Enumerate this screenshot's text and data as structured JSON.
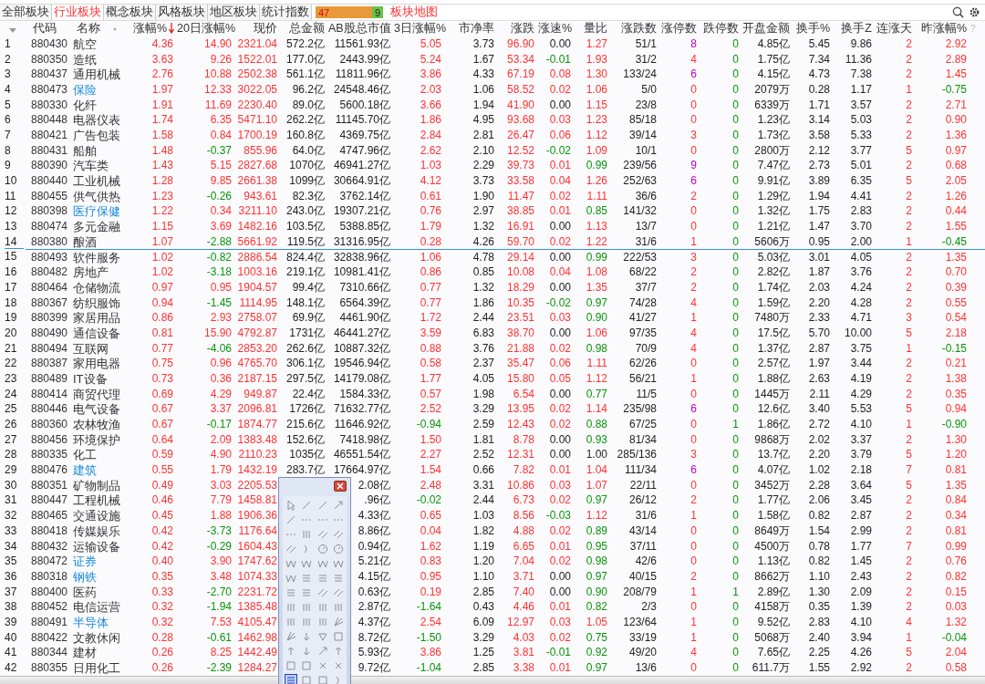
{
  "tabs": [
    {
      "label": "全部板块",
      "selected": false
    },
    {
      "label": "行业板块",
      "selected": true
    },
    {
      "label": "概念板块",
      "selected": false
    },
    {
      "label": "风格板块",
      "selected": false
    },
    {
      "label": "地区板块",
      "selected": false
    },
    {
      "label": "统计指数",
      "selected": false
    }
  ],
  "breadth": {
    "up": "47",
    "down": "9",
    "level": 0.84
  },
  "map_link": "板块地图",
  "tool_palette": {
    "open": true
  },
  "table": {
    "help_mark": "?",
    "columns": [
      {
        "kind": "index",
        "sorted": false
      },
      {
        "label": "代码",
        "kind": "code",
        "sorted": false
      },
      {
        "label": "名称",
        "kind": "name",
        "sorted": false
      },
      {
        "label": "涨幅%",
        "kind": "sign",
        "sorted": true
      },
      {
        "label": "20日涨幅%",
        "kind": "sign",
        "sorted": false
      },
      {
        "label": "现价",
        "kind": "follow",
        "sorted": false
      },
      {
        "label": "总金额",
        "kind": "plain",
        "sorted": false
      },
      {
        "label": "AB股总市值",
        "kind": "plain",
        "sorted": false
      },
      {
        "label": "3日涨幅%",
        "kind": "sign",
        "sorted": false
      },
      {
        "label": "市净率",
        "kind": "plain",
        "sorted": false
      },
      {
        "label": "涨跌",
        "kind": "follow",
        "sorted": false
      },
      {
        "label": "涨速%",
        "kind": "sign",
        "sorted": false
      },
      {
        "label": "量比",
        "kind": "ratio",
        "sorted": false
      },
      {
        "label": "涨跌数",
        "kind": "plain",
        "sorted": false
      },
      {
        "label": "涨停数",
        "kind": "limit_up",
        "sorted": false
      },
      {
        "label": "跌停数",
        "kind": "limit_down",
        "sorted": false
      },
      {
        "label": "开盘金额",
        "kind": "plain",
        "sorted": false
      },
      {
        "label": "换手%",
        "kind": "plain",
        "sorted": false
      },
      {
        "label": "换手Z",
        "kind": "plain",
        "sorted": false
      },
      {
        "label": "连涨天",
        "kind": "count",
        "sorted": false
      },
      {
        "label": "昨涨幅%",
        "kind": "sign",
        "sorted": false
      }
    ],
    "rows": [
      {
        "cells": [
          "1",
          "880430",
          "航空",
          "4.36",
          "14.90",
          "2321.04",
          "572.2亿",
          "11561.93亿",
          "5.05",
          "3.73",
          "96.90",
          "0.00",
          "1.27",
          "51/1",
          "8",
          "0",
          "4.85亿",
          "5.45",
          "9.86",
          "2",
          "2.92"
        ],
        "highlighted": false,
        "divider_after": false
      },
      {
        "cells": [
          "2",
          "880350",
          "造纸",
          "3.63",
          "9.26",
          "1522.01",
          "177.0亿",
          "2443.99亿",
          "5.24",
          "1.67",
          "53.34",
          "-0.01",
          "1.93",
          "31/2",
          "4",
          "0",
          "1.75亿",
          "7.34",
          "11.36",
          "2",
          "2.89"
        ],
        "highlighted": false,
        "divider_after": false
      },
      {
        "cells": [
          "3",
          "880437",
          "通用机械",
          "2.76",
          "10.88",
          "2502.38",
          "561.1亿",
          "11811.96亿",
          "3.86",
          "4.33",
          "67.19",
          "0.08",
          "1.30",
          "133/24",
          "6",
          "0",
          "4.15亿",
          "4.73",
          "7.38",
          "2",
          "1.45"
        ],
        "highlighted": false,
        "divider_after": false
      },
      {
        "cells": [
          "4",
          "880473",
          "保险",
          "1.97",
          "12.33",
          "3022.05",
          "96.2亿",
          "24548.46亿",
          "2.03",
          "1.06",
          "58.52",
          "0.02",
          "1.06",
          "5/0",
          "0",
          "0",
          "2079万",
          "0.28",
          "1.17",
          "1",
          "-0.75"
        ],
        "highlighted": true,
        "divider_after": false
      },
      {
        "cells": [
          "5",
          "880330",
          "化纤",
          "1.91",
          "11.69",
          "2230.40",
          "89.0亿",
          "5600.18亿",
          "3.66",
          "1.94",
          "41.90",
          "0.00",
          "1.15",
          "23/8",
          "0",
          "0",
          "6339万",
          "1.71",
          "3.57",
          "2",
          "2.71"
        ],
        "highlighted": false,
        "divider_after": false
      },
      {
        "cells": [
          "6",
          "880448",
          "电器仪表",
          "1.74",
          "6.35",
          "5471.10",
          "262.2亿",
          "11145.70亿",
          "1.86",
          "4.95",
          "93.68",
          "0.03",
          "1.23",
          "85/18",
          "0",
          "0",
          "1.23亿",
          "3.14",
          "5.03",
          "2",
          "0.90"
        ],
        "highlighted": false,
        "divider_after": false
      },
      {
        "cells": [
          "7",
          "880421",
          "广告包装",
          "1.58",
          "0.84",
          "1700.19",
          "160.8亿",
          "4369.75亿",
          "2.84",
          "2.81",
          "26.47",
          "0.06",
          "1.12",
          "39/14",
          "3",
          "0",
          "1.73亿",
          "3.58",
          "5.33",
          "2",
          "1.36"
        ],
        "highlighted": false,
        "divider_after": false
      },
      {
        "cells": [
          "8",
          "880431",
          "船舶",
          "1.48",
          "-0.37",
          "855.96",
          "64.0亿",
          "4747.96亿",
          "2.62",
          "2.10",
          "12.52",
          "-0.02",
          "1.09",
          "10/1",
          "0",
          "0",
          "2800万",
          "2.12",
          "3.77",
          "5",
          "0.97"
        ],
        "highlighted": false,
        "divider_after": false
      },
      {
        "cells": [
          "9",
          "880390",
          "汽车类",
          "1.43",
          "5.15",
          "2827.68",
          "1070亿",
          "46941.27亿",
          "1.03",
          "2.29",
          "39.73",
          "0.01",
          "0.99",
          "239/56",
          "9",
          "0",
          "7.47亿",
          "2.73",
          "5.01",
          "2",
          "0.68"
        ],
        "highlighted": false,
        "divider_after": false
      },
      {
        "cells": [
          "10",
          "880440",
          "工业机械",
          "1.28",
          "9.85",
          "2661.38",
          "1099亿",
          "30664.91亿",
          "4.12",
          "3.73",
          "33.58",
          "0.04",
          "1.26",
          "252/63",
          "6",
          "0",
          "9.91亿",
          "3.89",
          "6.35",
          "5",
          "2.05"
        ],
        "highlighted": false,
        "divider_after": false
      },
      {
        "cells": [
          "11",
          "880455",
          "供气供热",
          "1.23",
          "-0.26",
          "943.61",
          "82.3亿",
          "3762.14亿",
          "0.61",
          "1.90",
          "11.47",
          "0.02",
          "1.11",
          "36/6",
          "2",
          "0",
          "1.29亿",
          "1.94",
          "4.41",
          "2",
          "1.26"
        ],
        "highlighted": false,
        "divider_after": false
      },
      {
        "cells": [
          "12",
          "880398",
          "医疗保健",
          "1.22",
          "0.34",
          "3211.10",
          "243.0亿",
          "19307.21亿",
          "0.76",
          "2.97",
          "38.85",
          "0.01",
          "0.85",
          "141/32",
          "0",
          "0",
          "1.32亿",
          "1.75",
          "2.83",
          "2",
          "0.44"
        ],
        "highlighted": true,
        "divider_after": false
      },
      {
        "cells": [
          "13",
          "880474",
          "多元金融",
          "1.15",
          "3.69",
          "1482.16",
          "103.5亿",
          "5388.85亿",
          "1.79",
          "1.32",
          "16.91",
          "0.00",
          "1.13",
          "13/7",
          "0",
          "0",
          "1.21亿",
          "1.47",
          "3.70",
          "2",
          "1.55"
        ],
        "highlighted": false,
        "divider_after": false
      },
      {
        "cells": [
          "14",
          "880380",
          "酿酒",
          "1.07",
          "-2.88",
          "5661.92",
          "119.5亿",
          "31316.95亿",
          "0.28",
          "4.26",
          "59.70",
          "0.02",
          "1.22",
          "31/6",
          "1",
          "0",
          "5606万",
          "0.95",
          "2.00",
          "1",
          "-0.45"
        ],
        "highlighted": false,
        "divider_after": true
      },
      {
        "cells": [
          "15",
          "880493",
          "软件服务",
          "1.02",
          "-0.82",
          "2886.54",
          "824.4亿",
          "32838.96亿",
          "1.06",
          "4.78",
          "29.14",
          "0.00",
          "0.99",
          "222/53",
          "3",
          "0",
          "5.03亿",
          "3.01",
          "4.05",
          "2",
          "1.35"
        ],
        "highlighted": false,
        "divider_after": false
      },
      {
        "cells": [
          "16",
          "880482",
          "房地产",
          "1.02",
          "-3.18",
          "1003.16",
          "219.1亿",
          "10981.41亿",
          "0.86",
          "0.85",
          "10.08",
          "0.04",
          "1.08",
          "68/22",
          "2",
          "0",
          "2.82亿",
          "1.87",
          "3.76",
          "2",
          "0.70"
        ],
        "highlighted": false,
        "divider_after": false
      },
      {
        "cells": [
          "17",
          "880464",
          "仓储物流",
          "0.97",
          "0.95",
          "1904.57",
          "99.4亿",
          "7310.66亿",
          "0.77",
          "1.32",
          "18.29",
          "0.00",
          "1.35",
          "37/7",
          "2",
          "0",
          "1.74亿",
          "2.03",
          "4.24",
          "2",
          "0.39"
        ],
        "highlighted": false,
        "divider_after": false
      },
      {
        "cells": [
          "18",
          "880367",
          "纺织服饰",
          "0.94",
          "-1.45",
          "1114.95",
          "148.1亿",
          "6564.39亿",
          "0.77",
          "1.86",
          "10.35",
          "-0.02",
          "0.97",
          "74/28",
          "4",
          "0",
          "1.59亿",
          "2.20",
          "4.28",
          "2",
          "0.55"
        ],
        "highlighted": false,
        "divider_after": false
      },
      {
        "cells": [
          "19",
          "880399",
          "家居用品",
          "0.86",
          "2.93",
          "2758.07",
          "69.9亿",
          "4461.90亿",
          "1.72",
          "2.44",
          "23.51",
          "0.03",
          "0.90",
          "41/27",
          "1",
          "0",
          "7480万",
          "2.33",
          "4.71",
          "3",
          "0.54"
        ],
        "highlighted": false,
        "divider_after": false
      },
      {
        "cells": [
          "20",
          "880490",
          "通信设备",
          "0.81",
          "15.90",
          "4792.87",
          "1731亿",
          "46441.27亿",
          "3.59",
          "6.83",
          "38.70",
          "0.00",
          "1.06",
          "97/35",
          "4",
          "0",
          "17.5亿",
          "5.70",
          "10.00",
          "5",
          "2.18"
        ],
        "highlighted": false,
        "divider_after": false
      },
      {
        "cells": [
          "21",
          "880494",
          "互联网",
          "0.77",
          "-4.06",
          "2853.20",
          "262.6亿",
          "10887.32亿",
          "0.88",
          "3.76",
          "21.88",
          "0.02",
          "0.98",
          "70/9",
          "4",
          "0",
          "1.37亿",
          "2.87",
          "3.75",
          "1",
          "-0.15"
        ],
        "highlighted": false,
        "divider_after": false
      },
      {
        "cells": [
          "22",
          "880387",
          "家用电器",
          "0.75",
          "0.96",
          "4765.70",
          "306.1亿",
          "19546.94亿",
          "0.58",
          "2.37",
          "35.47",
          "0.06",
          "1.11",
          "62/26",
          "0",
          "0",
          "2.57亿",
          "1.97",
          "3.44",
          "2",
          "0.21"
        ],
        "highlighted": false,
        "divider_after": false
      },
      {
        "cells": [
          "23",
          "880489",
          "IT设备",
          "0.73",
          "0.36",
          "2187.15",
          "297.5亿",
          "14179.08亿",
          "1.77",
          "4.05",
          "15.80",
          "0.05",
          "1.12",
          "56/21",
          "1",
          "0",
          "1.88亿",
          "2.63",
          "4.19",
          "2",
          "1.38"
        ],
        "highlighted": false,
        "divider_after": false
      },
      {
        "cells": [
          "24",
          "880414",
          "商贸代理",
          "0.69",
          "4.29",
          "949.87",
          "22.4亿",
          "1584.33亿",
          "0.57",
          "1.98",
          "6.54",
          "0.00",
          "0.77",
          "11/5",
          "0",
          "0",
          "1445万",
          "2.11",
          "4.29",
          "2",
          "0.35"
        ],
        "highlighted": false,
        "divider_after": false
      },
      {
        "cells": [
          "25",
          "880446",
          "电气设备",
          "0.67",
          "3.37",
          "2096.81",
          "1726亿",
          "71632.77亿",
          "2.52",
          "3.29",
          "13.95",
          "0.02",
          "1.14",
          "235/98",
          "6",
          "0",
          "12.6亿",
          "3.40",
          "5.53",
          "5",
          "0.94"
        ],
        "highlighted": false,
        "divider_after": false
      },
      {
        "cells": [
          "26",
          "880360",
          "农林牧渔",
          "0.67",
          "-0.17",
          "1874.77",
          "215.6亿",
          "11646.92亿",
          "-0.94",
          "2.59",
          "12.43",
          "0.02",
          "0.88",
          "67/25",
          "0",
          "1",
          "1.86亿",
          "2.72",
          "4.10",
          "1",
          "-0.90"
        ],
        "highlighted": false,
        "divider_after": false
      },
      {
        "cells": [
          "27",
          "880456",
          "环境保护",
          "0.64",
          "2.09",
          "1383.48",
          "152.6亿",
          "7418.98亿",
          "1.50",
          "1.81",
          "8.78",
          "0.00",
          "0.93",
          "81/34",
          "0",
          "0",
          "9868万",
          "2.02",
          "3.37",
          "2",
          "1.30"
        ],
        "highlighted": false,
        "divider_after": false
      },
      {
        "cells": [
          "28",
          "880335",
          "化工",
          "0.59",
          "4.90",
          "2110.23",
          "1035亿",
          "46551.54亿",
          "2.27",
          "2.52",
          "12.31",
          "0.00",
          "1.00",
          "285/136",
          "3",
          "0",
          "13.7亿",
          "2.20",
          "3.79",
          "5",
          "1.20"
        ],
        "highlighted": false,
        "divider_after": false
      },
      {
        "cells": [
          "29",
          "880476",
          "建筑",
          "0.55",
          "1.79",
          "1432.19",
          "283.7亿",
          "17664.97亿",
          "1.54",
          "0.66",
          "7.82",
          "0.01",
          "1.04",
          "111/34",
          "6",
          "0",
          "4.07亿",
          "1.02",
          "2.18",
          "7",
          "0.81"
        ],
        "highlighted": true,
        "divider_after": false
      },
      {
        "cells": [
          "30",
          "880351",
          "矿物制品",
          "0.49",
          "3.03",
          "2205.53",
          null,
          "2.08亿",
          "2.48",
          "3.31",
          "10.86",
          "0.03",
          "1.07",
          "22/11",
          "0",
          "0",
          "3452万",
          "2.28",
          "3.64",
          "5",
          "1.35"
        ],
        "highlighted": false,
        "divider_after": false
      },
      {
        "cells": [
          "31",
          "880447",
          "工程机械",
          "0.46",
          "7.79",
          "1458.81",
          null,
          ".96亿",
          "-0.02",
          "2.44",
          "6.73",
          "0.02",
          "0.97",
          "26/12",
          "2",
          "0",
          "1.77亿",
          "2.06",
          "3.45",
          "2",
          "0.84"
        ],
        "highlighted": false,
        "divider_after": false
      },
      {
        "cells": [
          "32",
          "880465",
          "交通设施",
          "0.45",
          "1.88",
          "1906.36",
          null,
          "4.33亿",
          "0.65",
          "1.03",
          "8.56",
          "-0.03",
          "1.12",
          "31/6",
          "1",
          "0",
          "1.58亿",
          "0.82",
          "2.87",
          "2",
          "0.34"
        ],
        "highlighted": false,
        "divider_after": false
      },
      {
        "cells": [
          "33",
          "880418",
          "传媒娱乐",
          "0.42",
          "-3.73",
          "1176.64",
          null,
          "8.86亿",
          "0.04",
          "1.82",
          "4.88",
          "0.02",
          "0.89",
          "43/14",
          "0",
          "0",
          "8649万",
          "1.54",
          "2.99",
          "2",
          "0.81"
        ],
        "highlighted": false,
        "divider_after": false
      },
      {
        "cells": [
          "34",
          "880432",
          "运输设备",
          "0.42",
          "-0.29",
          "1604.43",
          null,
          "0.94亿",
          "1.62",
          "1.19",
          "6.65",
          "0.01",
          "0.95",
          "37/11",
          "0",
          "0",
          "4500万",
          "0.78",
          "1.77",
          "7",
          "0.99"
        ],
        "highlighted": false,
        "divider_after": false
      },
      {
        "cells": [
          "35",
          "880472",
          "证券",
          "0.40",
          "3.90",
          "1747.62",
          null,
          "5.21亿",
          "0.83",
          "1.20",
          "7.04",
          "0.02",
          "0.98",
          "42/6",
          "0",
          "0",
          "1.13亿",
          "0.82",
          "1.45",
          "2",
          "0.76"
        ],
        "highlighted": true,
        "divider_after": false
      },
      {
        "cells": [
          "36",
          "880318",
          "钢铁",
          "0.35",
          "3.48",
          "1074.33",
          null,
          "4.15亿",
          "0.95",
          "1.10",
          "3.71",
          "0.00",
          "0.97",
          "40/15",
          "2",
          "0",
          "8662万",
          "1.10",
          "2.43",
          "2",
          "0.82"
        ],
        "highlighted": true,
        "divider_after": false
      },
      {
        "cells": [
          "37",
          "880400",
          "医药",
          "0.33",
          "-2.70",
          "2231.72",
          null,
          "0.63亿",
          "0.19",
          "2.85",
          "7.40",
          "0.00",
          "0.90",
          "208/79",
          "1",
          "1",
          "2.89亿",
          "1.30",
          "2.09",
          "2",
          "0.15"
        ],
        "highlighted": false,
        "divider_after": false
      },
      {
        "cells": [
          "38",
          "880452",
          "电信运营",
          "0.32",
          "-1.94",
          "1385.48",
          null,
          "2.87亿",
          "-1.64",
          "0.43",
          "4.46",
          "0.01",
          "0.82",
          "2/3",
          "0",
          "0",
          "4158万",
          "0.35",
          "1.39",
          "2",
          "0.03"
        ],
        "highlighted": false,
        "divider_after": false
      },
      {
        "cells": [
          "39",
          "880491",
          "半导体",
          "0.32",
          "7.53",
          "4105.47",
          null,
          "4.37亿",
          "2.54",
          "6.09",
          "12.97",
          "0.03",
          "1.05",
          "123/64",
          "1",
          "0",
          "9.52亿",
          "2.83",
          "4.10",
          "4",
          "1.32"
        ],
        "highlighted": true,
        "divider_after": false
      },
      {
        "cells": [
          "40",
          "880422",
          "文教休闲",
          "0.28",
          "-0.61",
          "1462.98",
          null,
          "8.72亿",
          "-1.50",
          "3.29",
          "4.03",
          "0.02",
          "0.75",
          "33/19",
          "1",
          "0",
          "5068万",
          "2.40",
          "3.94",
          "1",
          "-0.04"
        ],
        "highlighted": false,
        "divider_after": false
      },
      {
        "cells": [
          "41",
          "880344",
          "建材",
          "0.26",
          "8.25",
          "1442.49",
          null,
          "5.93亿",
          "3.86",
          "1.25",
          "3.81",
          "-0.01",
          "0.92",
          "49/20",
          "4",
          "0",
          "7.65亿",
          "2.25",
          "4.26",
          "5",
          "2.04"
        ],
        "highlighted": false,
        "divider_after": false
      },
      {
        "cells": [
          "42",
          "880355",
          "日用化工",
          "0.26",
          "-2.39",
          "1284.27",
          null,
          "9.72亿",
          "-1.04",
          "2.85",
          "3.38",
          "0.01",
          "0.97",
          "13/6",
          "0",
          "0",
          "611.7万",
          "1.55",
          "2.92",
          "2",
          "0.58"
        ],
        "highlighted": false,
        "divider_after": false
      }
    ]
  }
}
